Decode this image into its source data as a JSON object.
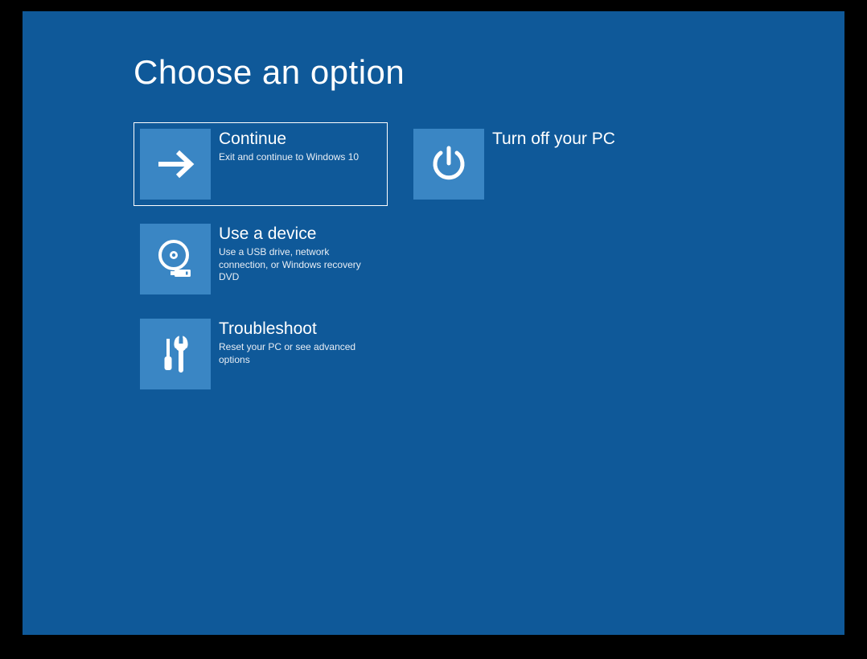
{
  "title": "Choose an option",
  "options": {
    "continue": {
      "title": "Continue",
      "desc": "Exit and continue to Windows 10"
    },
    "use_device": {
      "title": "Use a device",
      "desc": "Use a USB drive, network connection, or Windows recovery DVD"
    },
    "troubleshoot": {
      "title": "Troubleshoot",
      "desc": "Reset your PC or see advanced options"
    },
    "turn_off": {
      "title": "Turn off your PC",
      "desc": ""
    }
  }
}
